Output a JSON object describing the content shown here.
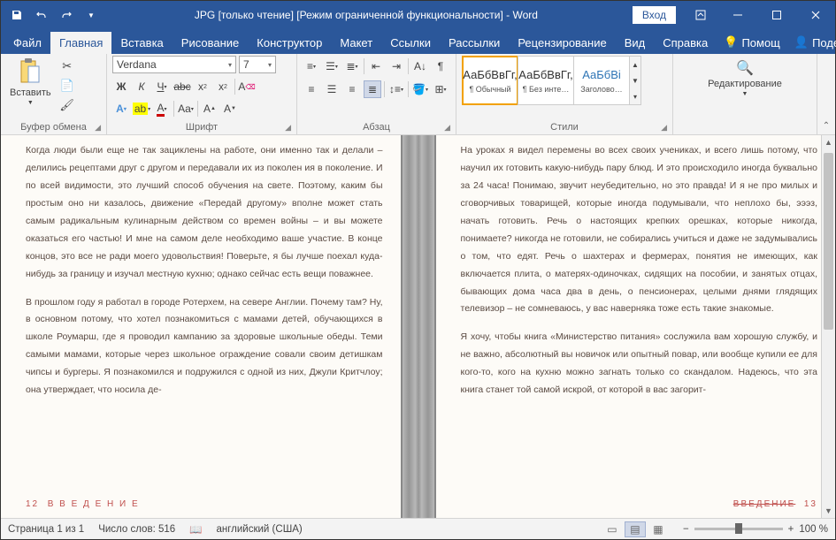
{
  "title": "JPG [только чтение] [Режим ограниченной функциональности]  -  Word",
  "account_button": "Вход",
  "tabs": {
    "file": "Файл",
    "home": "Главная",
    "insert": "Вставка",
    "draw": "Рисование",
    "design": "Конструктор",
    "layout": "Макет",
    "references": "Ссылки",
    "mailings": "Рассылки",
    "review": "Рецензирование",
    "view": "Вид",
    "help": "Справка",
    "tell_me": "Помощ",
    "share": "Поделиться"
  },
  "ribbon": {
    "clipboard": {
      "label": "Буфер обмена",
      "paste": "Вставить"
    },
    "font": {
      "label": "Шрифт",
      "name": "Verdana",
      "size": "7"
    },
    "paragraph": {
      "label": "Абзац"
    },
    "styles": {
      "label": "Стили",
      "preview": "АаБбВвГг,",
      "preview3": "АаБбВі",
      "s1": "¶ Обычный",
      "s2": "¶ Без инте…",
      "s3": "Заголово…"
    },
    "editing": {
      "label": "Редактирование"
    }
  },
  "doc": {
    "left_p1": "Когда люди были еще не так зациклены на работе, они именно так и де­лали – делились рецептами друг с другом и передавали их из поколен ия в поколение. И по всей видимости, это лучший способ обучения на свете. Поэтому, каким бы простым оно ни казалось, движение «Передай друго­му» вполне может стать самым радикальным кулинарным действом со вре­мен войны – и вы можете оказаться его частью! И мне на самом деле необ­ходимо ваше участие. В конце концов, это все не ради моего удовольствия! Поверьте, я бы лучше поехал куда-нибудь за границу и изучал местную кух­ню; однако сейчас есть вещи поважнее.",
    "left_p2": "В прошлом году я работал в городе Ротерхем, на севере Англии. Почему там? Ну, в основном потому, что хотел познакомиться с мамами детей, обучающихся в школе Роумарш, где я проводил кампанию за здоровые школьные обеды. Теми самыми мамами, которые через школьное ограж­дение совали своим детишкам чипсы и бургеры. Я познакомился и подру­жился с одной из них, Джули Критчлоу; она утверждает, что носила де-",
    "left_footer_num": "12",
    "left_footer_text": "В В Е Д Е Н И Е",
    "right_p1": "На уроках я видел перемены во всех своих учениках, и всего лишь потому, что научил их готовить какую-нибудь пару блюд. И это происходило ино­гда буквально за 24 часа! Понимаю, звучит неубедительно, но это правда! И я не про милых и сговорчивых товарищей, которые иногда подумывали, что неплохо бы, эээз, начать готовить. Речь о настоящих крепких орешках, которые никогда, понимаете? никогда не готовили, не собирались учиться и даже не задумывались о том, что едят. Речь о шахтерах и фермерах, понятия не имеющих, как включается плита, о матерях-одиночках, сидящих на пособии, и занятых отцах, бывающих дома часа два в день, о пенсионерах, целыми днями глядящих телевизор – не сомневаюсь, у вас наверняка тоже есть такие знакомые.",
    "right_p2": "Я хочу, чтобы книга «Министерство питания» сослужила вам хорошую служ­бу, и не важно, абсолютный вы новичок или опытный повар, или вообще ку­пили ее для кого-то, кого на кухню можно загнать только со скандалом. Надеюсь, что эта книга станет той самой искрой, от которой в вас загорит-",
    "right_footer_text": "ВВЕДЕНИЕ",
    "right_footer_num": "13"
  },
  "status": {
    "page": "Страница 1 из 1",
    "words": "Число слов: 516",
    "lang": "английский (США)",
    "zoom": "100 %"
  }
}
